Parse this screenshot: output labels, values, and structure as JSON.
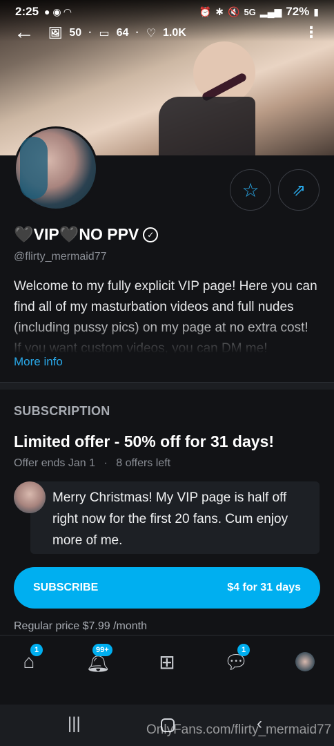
{
  "status_bar": {
    "time": "2:25",
    "network": "5G",
    "battery": "72%"
  },
  "cover_stats": {
    "photos": "50",
    "videos": "64",
    "likes": "1.0K"
  },
  "profile": {
    "name": "🖤VIP🖤NO PPV",
    "handle": "@flirty_mermaid77",
    "bio": "Welcome to my fully explicit VIP page! Here you can find all of my masturbation videos and full nudes (including pussy pics) on my page at no extra cost! If you want custom videos, you can DM me!",
    "more_info": "More info"
  },
  "subscription": {
    "section_title": "SUBSCRIPTION",
    "offer_title": "Limited offer - 50% off for 31 days!",
    "offer_ends": "Offer ends Jan 1",
    "offers_left": "8 offers left",
    "message": "Merry Christmas! My VIP page is half off right now for the first 20 fans. Cum enjoy more of me.",
    "subscribe_label": "SUBSCRIBE",
    "subscribe_price": "$4 for 31 days",
    "regular_price": "Regular price $7.99 /month"
  },
  "bottom_nav": {
    "home_badge": "1",
    "notifications_badge": "99+",
    "messages_badge": "1"
  },
  "watermark": "OnlyFans.com/flirty_mermaid77",
  "colors": {
    "accent": "#00aff0",
    "background": "#121316"
  }
}
